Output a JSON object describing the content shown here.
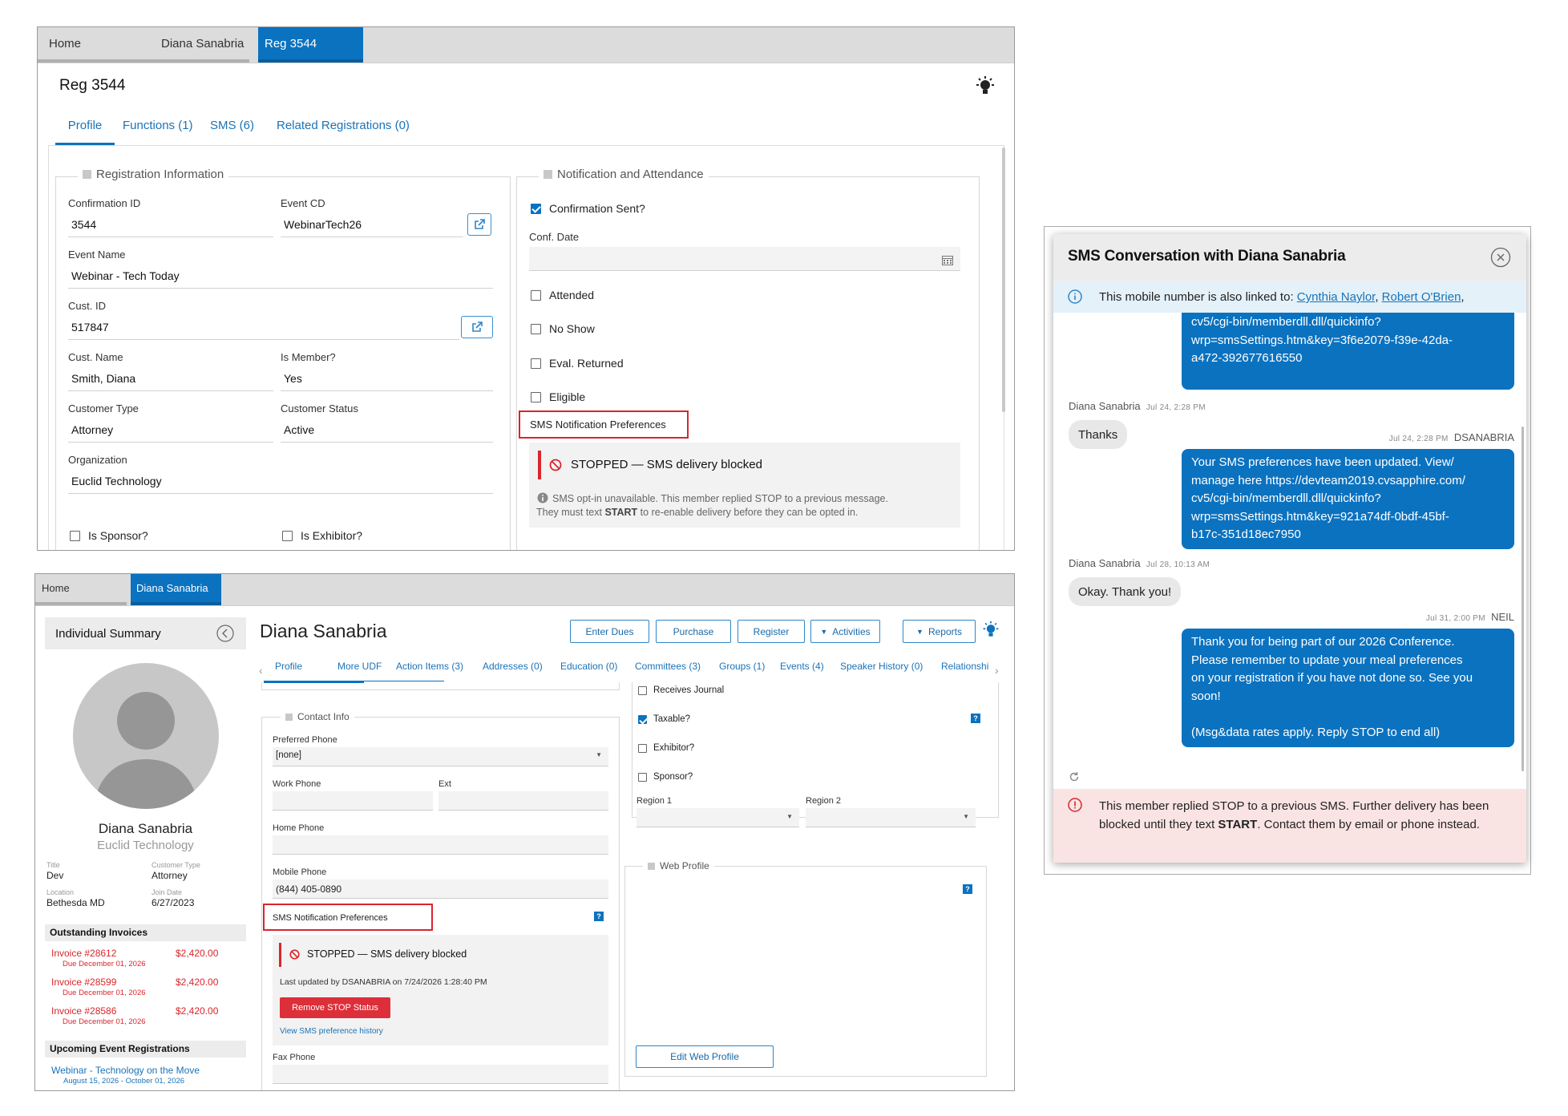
{
  "top_window": {
    "tabs": [
      "Home",
      "Diana Sanabria",
      "Reg 3544"
    ],
    "page_title": "Reg 3544",
    "subtabs": [
      "Profile",
      "Functions (1)",
      "SMS (6)",
      "Related Registrations (0)"
    ],
    "reg_info": {
      "title": "Registration Information",
      "confirmation_id_label": "Confirmation ID",
      "confirmation_id": "3544",
      "event_cd_label": "Event CD",
      "event_cd": "WebinarTech26",
      "event_name_label": "Event Name",
      "event_name": "Webinar - Tech Today",
      "cust_id_label": "Cust. ID",
      "cust_id": "517847",
      "cust_name_label": "Cust. Name",
      "cust_name": "Smith, Diana",
      "is_member_label": "Is Member?",
      "is_member": "Yes",
      "customer_type_label": "Customer Type",
      "customer_type": "Attorney",
      "customer_status_label": "Customer Status",
      "customer_status": "Active",
      "organization_label": "Organization",
      "organization": "Euclid Technology",
      "is_sponsor_label": "Is Sponsor?",
      "is_exhibitor_label": "Is Exhibitor?"
    },
    "notification": {
      "title": "Notification and Attendance",
      "confirmation_sent": "Confirmation Sent?",
      "conf_date_label": "Conf. Date",
      "attended": "Attended",
      "no_show": "No Show",
      "eval_returned": "Eval. Returned",
      "eligible": "Eligible",
      "sms_pref_label": "SMS Notification Preferences",
      "stopped_text": "STOPPED — SMS delivery blocked",
      "info_line1": "SMS opt-in unavailable. This member replied STOP to a previous message.",
      "info_line2_pre": "They must text ",
      "info_line2_bold": "START",
      "info_line2_post": " to re-enable delivery before they can be opted in."
    }
  },
  "bottom_window": {
    "tabs": [
      "Home",
      "Diana Sanabria"
    ],
    "summary_title": "Individual Summary",
    "person_name": "Diana Sanabria",
    "org": "Euclid Technology",
    "title_label": "Title",
    "title_value": "Dev",
    "ctype_label": "Customer Type",
    "ctype_value": "Attorney",
    "location_label": "Location",
    "location_value": "Bethesda MD",
    "join_label": "Join Date",
    "join_value": "6/27/2023",
    "invoices_title": "Outstanding Invoices",
    "invoices": [
      {
        "name": "Invoice #28612",
        "amount": "$2,420.00",
        "due": "Due December 01, 2026"
      },
      {
        "name": "Invoice #28599",
        "amount": "$2,420.00",
        "due": "Due December 01, 2026"
      },
      {
        "name": "Invoice #28586",
        "amount": "$2,420.00",
        "due": "Due December 01, 2026"
      }
    ],
    "events_title": "Upcoming Event Registrations",
    "event_name": "Webinar - Technology on the Move",
    "event_dates": "August 15, 2026 - October 01, 2026",
    "main_title": "Diana Sanabria",
    "actions": [
      "Enter Dues",
      "Purchase",
      "Register",
      "Activities",
      "Reports"
    ],
    "subtabs": [
      "Profile",
      "More UDF",
      "Action Items (3)",
      "Addresses (0)",
      "Education (0)",
      "Committees (3)",
      "Groups (1)",
      "Events (4)",
      "Speaker History (0)",
      "Relationshi"
    ],
    "contact_title": "Contact Info",
    "preferred_phone_label": "Preferred Phone",
    "preferred_phone": "[none]",
    "work_phone_label": "Work Phone",
    "ext_label": "Ext",
    "home_phone_label": "Home Phone",
    "mobile_phone_label": "Mobile Phone",
    "mobile_phone": "(844) 405-0890",
    "sms_pref_label": "SMS Notification Preferences",
    "stopped_text": "STOPPED — SMS delivery blocked",
    "last_updated": "Last updated by DSANABRIA on 7/24/2026 1:28:40 PM",
    "remove_stop": "Remove STOP Status",
    "history_link": "View SMS preference history",
    "fax_label": "Fax Phone",
    "receives_journal": "Receives Journal",
    "taxable": "Taxable?",
    "exhibitor": "Exhibitor?",
    "sponsor": "Sponsor?",
    "region1": "Region 1",
    "region2": "Region 2",
    "web_profile_title": "Web Profile",
    "edit_web_profile": "Edit Web Profile"
  },
  "sms_dialog": {
    "title": "SMS Conversation with Diana Sanabria",
    "linked_text": "This mobile number is also linked to: ",
    "linked_names": [
      "Cynthia Naylor",
      "Robert O'Brien"
    ],
    "msg0": [
      "cv5/cgi-bin/memberdll.dll/quickinfo?",
      "wrp=smsSettings.htm&key=3f6e2079-f39e-42da-",
      "a472-392677616550"
    ],
    "meta1_name": "Diana Sanabria",
    "meta1_time": "Jul 24, 2:28 PM",
    "in1": "Thanks",
    "meta2_time": "Jul 24, 2:28 PM",
    "meta2_name": "DSANABRIA",
    "msg2": [
      "Your SMS preferences have been updated. View/",
      "manage here https://devteam2019.cvsapphire.com/",
      "cv5/cgi-bin/memberdll.dll/quickinfo?",
      "wrp=smsSettings.htm&key=921a74df-0bdf-45bf-",
      "b17c-351d18ec7950"
    ],
    "meta3_name": "Diana Sanabria",
    "meta3_time": "Jul 28, 10:13 AM",
    "in2": "Okay. Thank you!",
    "meta4_time": "Jul 31, 2:00 PM",
    "meta4_name": "NEIL",
    "msg4": [
      "Thank you for being part of our 2026 Conference.",
      "Please remember to update your meal preferences",
      "on your registration if you have not done so. See you",
      "soon!",
      "",
      "(Msg&data rates apply. Reply STOP to end all)"
    ],
    "error_pre": "This member replied STOP to a previous SMS. Further delivery has been blocked until they text ",
    "error_bold": "START",
    "error_post": ". Contact them by email or phone instead."
  }
}
